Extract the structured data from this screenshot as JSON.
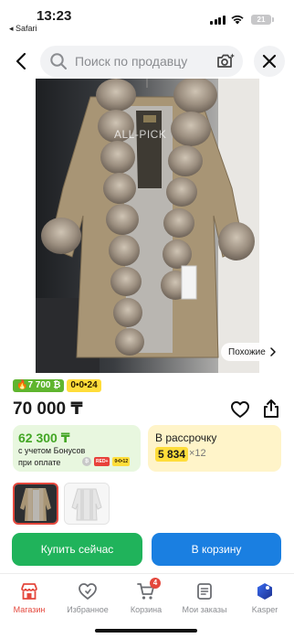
{
  "status_bar": {
    "time": "13:23",
    "back_app": "◂ Safari",
    "battery": "21"
  },
  "header": {
    "search_placeholder": "Поиск по продавцу"
  },
  "product": {
    "watermark": "ALL-PICK",
    "similar_label": "Похожие",
    "badges": [
      {
        "text": "🔥7 700 ₿",
        "color": "#5fb52e"
      },
      {
        "text": "0•0•24",
        "color": "#ffdd3a"
      }
    ],
    "price": "70 000 ₸",
    "bonus": {
      "amount": "62 300 ₸",
      "line1": "с учетом Бонусов",
      "line2": "при оплате",
      "icons": [
        "₿",
        "RED+",
        "0•0•12"
      ]
    },
    "installment": {
      "title": "В рассрочку",
      "monthly": "5 834",
      "multiplier": "×12"
    }
  },
  "actions": {
    "buy_now": "Купить сейчас",
    "add_to_cart": "В корзину"
  },
  "tabbar": {
    "items": [
      {
        "label": "Магазин",
        "icon": "shop-icon",
        "active": true
      },
      {
        "label": "Избранное",
        "icon": "heart-icon",
        "active": false
      },
      {
        "label": "Корзина",
        "icon": "cart-icon",
        "active": false,
        "count": "4"
      },
      {
        "label": "Мои заказы",
        "icon": "orders-icon",
        "active": false
      },
      {
        "label": "Kasper",
        "icon": "kasper-icon",
        "active": false
      }
    ]
  },
  "colors": {
    "accent_red": "#e4473c",
    "buy_green": "#20b35b",
    "cart_blue": "#1a7fe1",
    "bonus_green": "#43a625",
    "installment_yellow": "#ffdd3a"
  }
}
